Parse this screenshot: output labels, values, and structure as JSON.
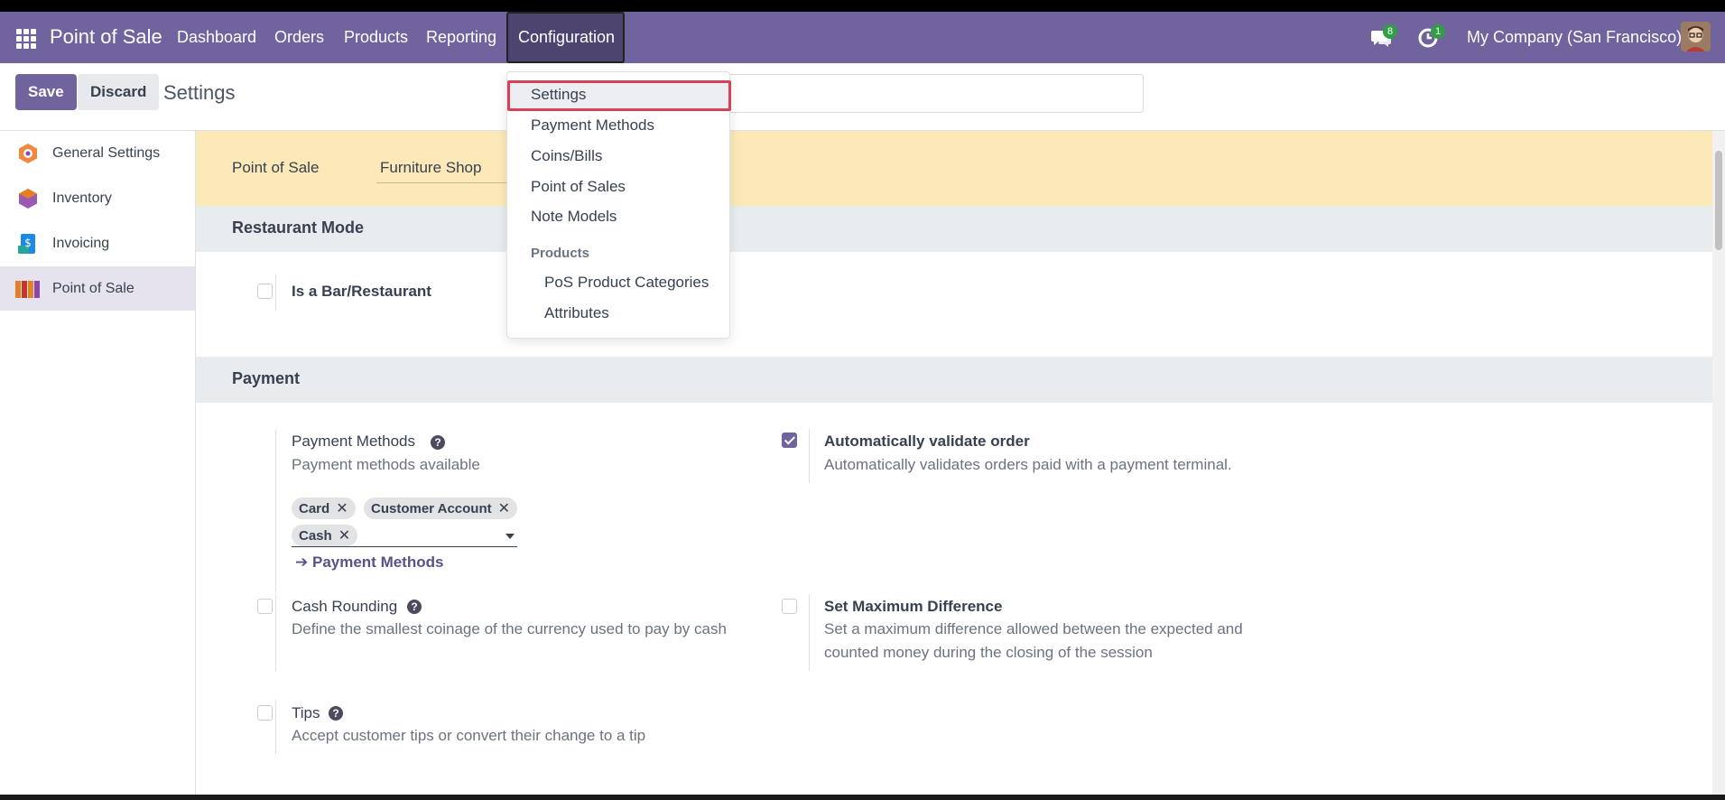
{
  "navbar": {
    "brand": "Point of Sale",
    "menu": [
      "Dashboard",
      "Orders",
      "Products",
      "Reporting",
      "Configuration"
    ],
    "messages_count": "8",
    "activities_count": "1",
    "company": "My Company (San Francisco)"
  },
  "control": {
    "save_label": "Save",
    "discard_label": "Discard",
    "title": "Settings"
  },
  "sidebar": {
    "items": [
      {
        "label": "General Settings",
        "icon": "general-settings-icon"
      },
      {
        "label": "Inventory",
        "icon": "inventory-icon"
      },
      {
        "label": "Invoicing",
        "icon": "invoicing-icon"
      },
      {
        "label": "Point of Sale",
        "icon": "point-of-sale-icon"
      }
    ]
  },
  "main": {
    "pos_label": "Point of Sale",
    "pos_value": "Furniture Shop",
    "restaurant_section": "Restaurant Mode",
    "bar_restaurant_label": "Is a Bar/Restaurant",
    "payment_section": "Payment",
    "payment_methods": {
      "title": "Payment Methods",
      "desc": "Payment methods available",
      "tags": [
        "Card",
        "Customer Account",
        "Cash"
      ],
      "link": "Payment Methods"
    },
    "auto_validate": {
      "title": "Automatically validate order",
      "desc": "Automatically validates orders paid with a payment terminal.",
      "checked": true
    },
    "cash_rounding": {
      "title": "Cash Rounding",
      "desc": "Define the smallest coinage of the currency used to pay by cash"
    },
    "max_difference": {
      "title": "Set Maximum Difference",
      "desc_line1": "Set a maximum difference allowed between the expected and",
      "desc_line2": "counted money during the closing of the session"
    },
    "tips": {
      "title": "Tips",
      "desc": "Accept customer tips or convert their change to a tip"
    }
  },
  "dropdown": {
    "items": [
      "Settings",
      "Payment Methods",
      "Coins/Bills",
      "Point of Sales",
      "Note Models"
    ],
    "products_header": "Products",
    "product_items": [
      "PoS Product Categories",
      "Attributes"
    ]
  },
  "colors": {
    "brand": "#71639e",
    "highlight": "#d64359",
    "badge": "#2f9e44",
    "banner": "#fde8b7"
  }
}
